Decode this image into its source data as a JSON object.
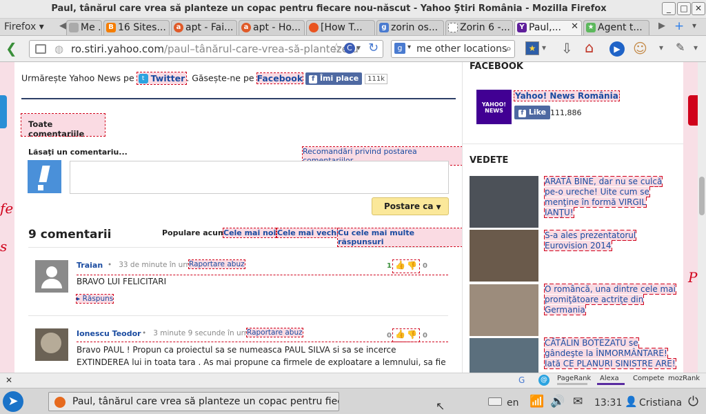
{
  "window": {
    "title": "Paul, tânărul care vrea să planteze un copac pentru fiecare nou-născut - Yahoo Ştiri România - Mozilla Firefox"
  },
  "tabs": {
    "menu": "Firefox",
    "items": [
      {
        "label": "Me ...",
        "icon": "page-icon"
      },
      {
        "label": "16 Sites...",
        "icon": "blogger-icon"
      },
      {
        "label": "apt - Fai...",
        "icon": "ask-icon"
      },
      {
        "label": "apt - Ho...",
        "icon": "ask-icon"
      },
      {
        "label": "[How T...",
        "icon": "ubuntu-icon"
      },
      {
        "label": "zorin os...",
        "icon": "google-icon"
      },
      {
        "label": "Zorin 6 -...",
        "icon": "page-icon"
      },
      {
        "label": "Paul,...",
        "icon": "yahoo-icon"
      },
      {
        "label": "Agent t...",
        "icon": "star-icon"
      }
    ]
  },
  "nav": {
    "url_host": "ro.stiri.yahoo.com",
    "url_path": "/paul–tânărul-care-vrea-să-planteze-u",
    "search_text": "me other locations"
  },
  "follow": {
    "prefix": "Urmărește Yahoo News pe",
    "twitter": "Twitter",
    "middle": "Găsește-ne pe",
    "facebook": "Facebook",
    "like_label": "Îmi place",
    "like_count": "111k"
  },
  "comments_box": {
    "tab_label": "Toate comentariile",
    "leave_label": "Lăsaţi un comentariu...",
    "guidelines": "Recomandări privind postarea comentariilor",
    "post_button": "Postare ca",
    "count_title": "9 comentarii",
    "sort_label": "Populare acum",
    "sort_options": [
      "Cele mai noi",
      "Cele mai vechi",
      "Cu cele mai multe răspunsuri"
    ]
  },
  "comments": [
    {
      "author": "Traian",
      "time": "33 de minute în urmă",
      "report": "Raportare abuz",
      "up": "1",
      "down": "0",
      "text": [
        "BRAVO LUI FELICITARI"
      ],
      "reply": "Răspuns"
    },
    {
      "author": "Ionescu Teodor",
      "time": "3 minute 9 secunde în urmă",
      "report": "Raportare abuz",
      "up": "0",
      "down": "0",
      "text": [
        "Bravo PAUL ! Propun ca proiectul sa se numeasca PAUL SILVA si sa se incerce",
        "EXTINDEREA lui in toata tara . As mai propune ca firmele de exploatare a lemnului, sa fie"
      ]
    }
  ],
  "sidebar": {
    "facebook_title": "FACEBOOK",
    "fb_page_name": "Yahoo! News România",
    "fb_logo": "YAHOO! NEWS",
    "fb_like": "Like",
    "fb_count": "111,886",
    "vedete_title": "VEDETE",
    "vedete": [
      "ARATĂ BINE, dar nu se culcă pe-o ureche! Uite cum se menţine în formă VIRGIL IANŢU!",
      "S-a ales prezentatorul Eurovision 2014",
      "O româncă, una dintre cele mai promiţătoare actriţe din Germania",
      "CĂTĂLIN BOTEZATU se gândeşte la ÎNMORMÂNTARE! Iată CE PLANURI SINISTRE ARE!"
    ]
  },
  "statusbar": {
    "pagerank": "PageRank",
    "alexa": "Alexa",
    "compete": "Compete",
    "mozrank": "mozRank"
  },
  "taskbar": {
    "window_label": "Paul, tânărul care vrea să planteze un copac pentru fiec...",
    "lang": "en",
    "time": "13:31",
    "user": "Cristiana"
  },
  "colors": {
    "accent": "#1a4ba0",
    "highlight_outline": "#d0021b",
    "highlight_bg": "#fadbe3",
    "page_bg": "#f8dfe6",
    "facebook": "#4e69a2"
  }
}
